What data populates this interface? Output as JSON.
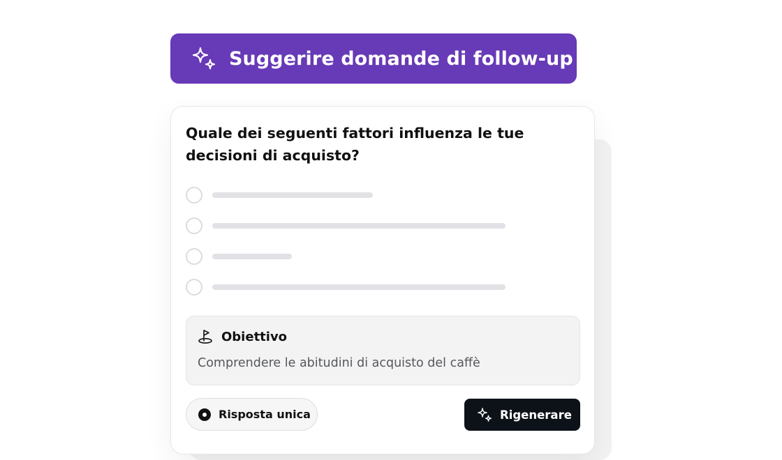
{
  "banner": {
    "icon": "sparkles-icon",
    "title": "Suggerire domande di follow-up",
    "background": "#673AB7"
  },
  "card": {
    "question": "Quale dei seguenti fattori influenza le tue decisioni di acquisto?",
    "options_count": 4,
    "goal": {
      "icon": "golf-flag-icon",
      "label": "Obiettivo",
      "text": "Comprendere le abitudini di acquisto del caffè"
    },
    "answer_type": {
      "icon": "radio-selected-icon",
      "label": "Risposta unica"
    },
    "regenerate": {
      "icon": "sparkles-icon",
      "label": "Rigenerare",
      "background": "#0C1218"
    }
  }
}
